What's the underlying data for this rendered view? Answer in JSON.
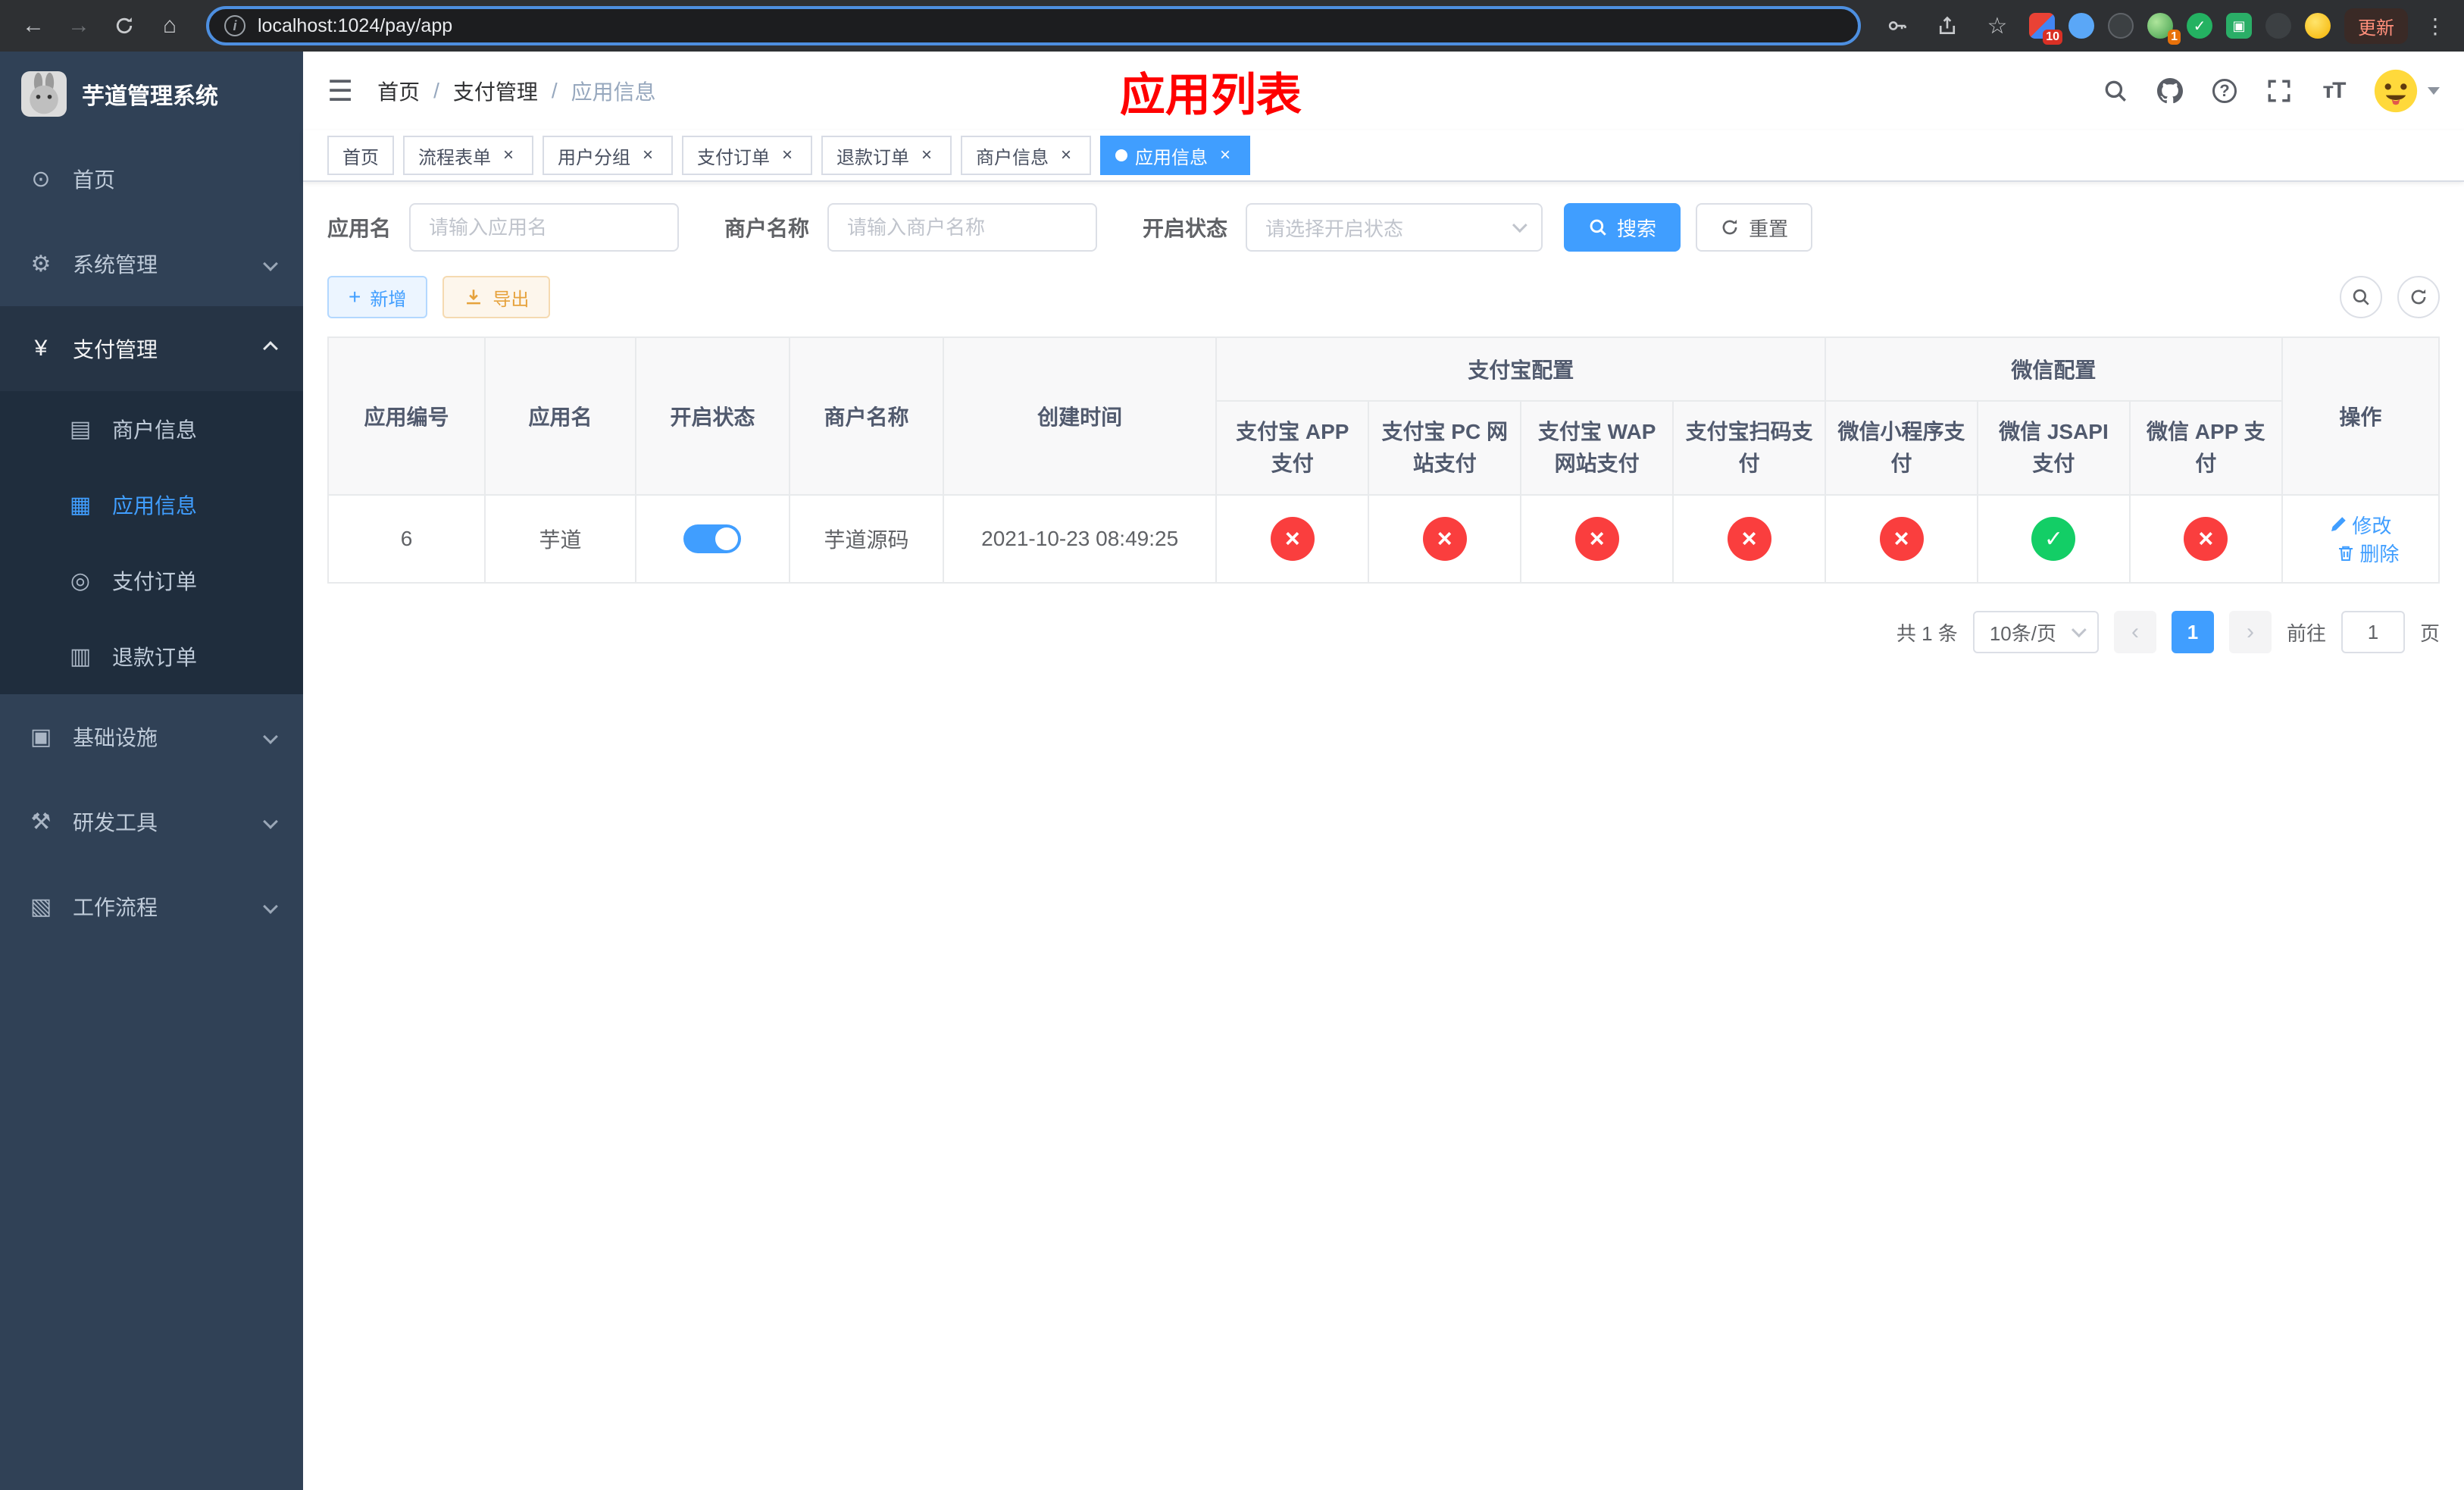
{
  "ui_colors": {
    "primary": "#409eff",
    "danger": "#fa3e3e",
    "success": "#13ce66",
    "title_red": "#ff0000",
    "sidebar_bg": "#304156",
    "submenu_bg": "#1f2d3d",
    "add_button": "#ecf5ff",
    "export_button": "#fdf6ec"
  },
  "icons": [
    "back-icon",
    "forward-icon",
    "reload-icon",
    "home-icon",
    "site-info-icon",
    "key-icon",
    "share-icon",
    "star-icon",
    "search-icon",
    "github-icon",
    "help-icon",
    "fullscreen-icon",
    "font-size-icon",
    "chevron-down-icon",
    "close-icon",
    "plus-icon",
    "download-icon",
    "refresh-icon",
    "edit-icon",
    "delete-icon"
  ],
  "browser": {
    "url": "localhost:1024/pay/app",
    "update_button": "更新",
    "extension_badge_1": "10",
    "extension_badge_2": "1"
  },
  "sidebar": {
    "logo_title": "芋道管理系统",
    "items": [
      {
        "label": "首页",
        "icon": "dashboard-icon"
      },
      {
        "label": "系统管理",
        "icon": "gear-icon"
      },
      {
        "label": "支付管理",
        "icon": "yen-icon",
        "children": [
          {
            "label": "商户信息",
            "icon": "bank-card-icon"
          },
          {
            "label": "应用信息",
            "icon": "app-grid-icon"
          },
          {
            "label": "支付订单",
            "icon": "pay-order-icon"
          },
          {
            "label": "退款订单",
            "icon": "refund-order-icon"
          }
        ]
      },
      {
        "label": "基础设施",
        "icon": "infra-icon"
      },
      {
        "label": "研发工具",
        "icon": "tools-icon"
      },
      {
        "label": "工作流程",
        "icon": "workflow-icon"
      }
    ]
  },
  "header": {
    "breadcrumb": [
      "首页",
      "支付管理",
      "应用信息"
    ],
    "separator": "/",
    "page_title": "应用列表"
  },
  "tabs": [
    {
      "label": "首页"
    },
    {
      "label": "流程表单"
    },
    {
      "label": "用户分组"
    },
    {
      "label": "支付订单"
    },
    {
      "label": "退款订单"
    },
    {
      "label": "商户信息"
    },
    {
      "label": "应用信息"
    }
  ],
  "search_form": {
    "app_name_label": "应用名",
    "app_name_placeholder": "请输入应用名",
    "merchant_label": "商户名称",
    "merchant_placeholder": "请输入商户名称",
    "status_label": "开启状态",
    "status_placeholder": "请选择开启状态",
    "search_button": "搜索",
    "reset_button": "重置"
  },
  "toolbar": {
    "add_button": "新增",
    "export_button": "导出"
  },
  "table": {
    "columns": {
      "app_id": "应用编号",
      "app_name": "应用名",
      "status": "开启状态",
      "merchant": "商户名称",
      "created": "创建时间",
      "alipay_group": "支付宝配置",
      "wechat_group": "微信配置",
      "alipay_app": "支付宝 APP 支付",
      "alipay_pc": "支付宝 PC 网站支付",
      "alipay_wap": "支付宝 WAP 网站支付",
      "alipay_qr": "支付宝扫码支付",
      "wx_mini": "微信小程序支付",
      "wx_jsapi": "微信 JSAPI 支付",
      "wx_app": "微信 APP 支付",
      "actions": "操作"
    },
    "rows": [
      {
        "app_id": "6",
        "app_name": "芋道",
        "status_on": true,
        "merchant": "芋道源码",
        "created": "2021-10-23 08:49:25",
        "configs": [
          "fail",
          "fail",
          "fail",
          "fail",
          "fail",
          "success",
          "fail"
        ],
        "edit": "修改",
        "delete": "删除"
      }
    ]
  },
  "pagination": {
    "total": "共 1 条",
    "page_size": "10条/页",
    "current_page": "1",
    "goto_label": "前往",
    "goto_value": "1",
    "goto_suffix": "页"
  }
}
